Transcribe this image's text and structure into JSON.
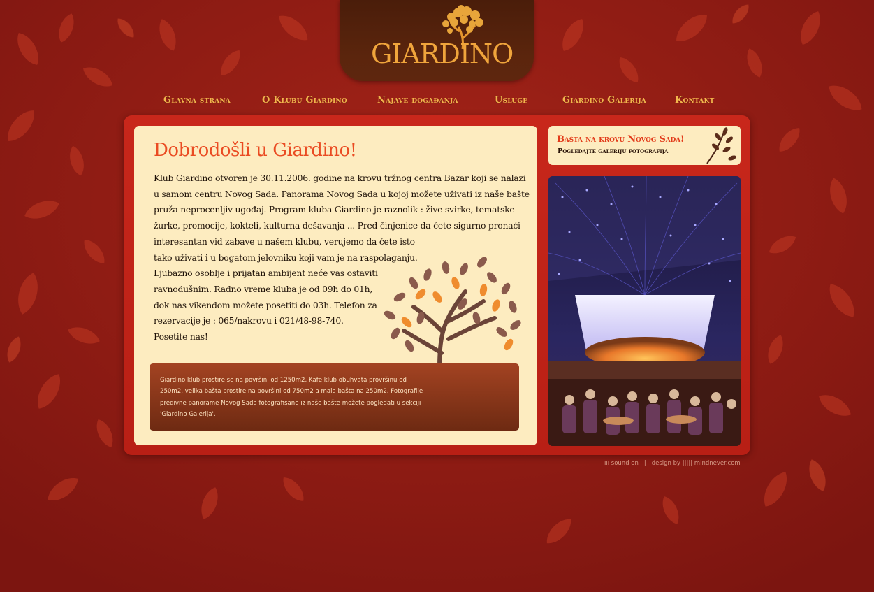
{
  "logo": {
    "text": "GIARDINO"
  },
  "nav": {
    "items": [
      {
        "label": "Glavna strana"
      },
      {
        "label": "O Klubu Giardino"
      },
      {
        "label": "Najave događanja"
      },
      {
        "label": "Usluge"
      },
      {
        "label": "Giardino Galerija"
      },
      {
        "label": "Kontakt"
      }
    ]
  },
  "main": {
    "title": "Dobrodošli u Giardino!",
    "paragraph_lines": [
      "Klub Giardino otvoren je 30.11.2006. godine na krovu tržnog centra Bazar koji se nalazi",
      "u samom centru Novog Sada. Panorama Novog Sada u kojoj možete uživati iz naše bašte",
      "pruža neprocenljiv ugođaj. Program kluba Giardino je raznolik : žive svirke, tematske",
      "žurke, promocije, kokteli, kulturna dešavanja ... Pred činjenice da ćete sigurno pronaći",
      "interesantan vid zabave u našem klubu, verujemo da ćete isto",
      "tako uživati i u bogatom jelovniku koji vam je na raspolaganju.",
      "Ljubazno osoblje i prijatan ambijent neće vas ostaviti",
      "ravnodušnim. Radno vreme kluba je od 09h do 01h,",
      "dok nas vikendom možete posetiti do 03h.  Telefon za",
      "rezervacije je : 065/nakrovu i 021/48-98-740.",
      "Posetite nas!"
    ],
    "info_lines": [
      "Giardino klub prostire se na površini od 1250m2. Kafe klub obuhvata provršinu od",
      "250m2, velika bašta prostire na površini od 750m2 a mala bašta na 250m2. Fotografije",
      "predivne panorame Novog Sada fotografisane iz naše bašte možete pogledati u sekciji",
      "'Giardino Galerija'."
    ]
  },
  "sidebar": {
    "banner_title": "Bašta na krovu Novog Sada!",
    "banner_subtitle": "Pogledajte galeriju fotografija"
  },
  "footer": {
    "sound": "ııı sound on",
    "separator": "|",
    "design": "design by ||||| mindnever.com"
  },
  "colors": {
    "background": "#8e1a12",
    "frame": "#c8271b",
    "panel": "#fdecc0",
    "title_orange": "#ea4b22",
    "nav_gold": "#f2b64d",
    "logo_brown": "#4a1d0a"
  }
}
